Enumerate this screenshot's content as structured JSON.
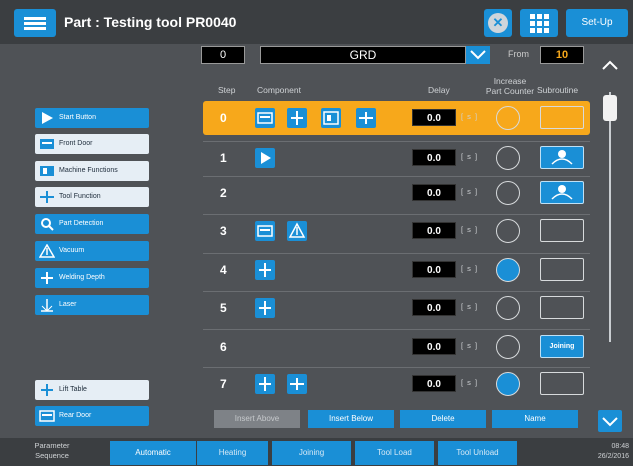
{
  "header": {
    "title": "Part : Testing tool PR0040",
    "setup_label": "Set-Up"
  },
  "selector": {
    "step_value": "0",
    "sequence_name": "GRD",
    "from_label": "From",
    "from_value": "10"
  },
  "columns": {
    "step": "Step",
    "component": "Component",
    "delay": "Delay",
    "increase_counter": "Increase\nPart Counter",
    "subroutine": "Subroutine"
  },
  "sidebar": {
    "items": [
      {
        "label": "Start Button",
        "icon": "play-icon"
      },
      {
        "label": "Front Door",
        "icon": "door-icon"
      },
      {
        "label": "Machine Functions",
        "icon": "machine-icon"
      },
      {
        "label": "Tool Function",
        "icon": "tool-icon"
      },
      {
        "label": "Part Detection",
        "icon": "detection-icon"
      },
      {
        "label": "Vacuum",
        "icon": "vacuum-icon"
      },
      {
        "label": "Welding Depth",
        "icon": "welding-depth-icon"
      },
      {
        "label": "Laser",
        "icon": "laser-icon"
      },
      {
        "label": "Lift Table",
        "icon": "lift-table-icon"
      },
      {
        "label": "Rear Door",
        "icon": "rear-door-icon"
      }
    ]
  },
  "rows": [
    {
      "step": "0",
      "delay": "0.0",
      "unit": "[ s ]",
      "subroutine": ""
    },
    {
      "step": "1",
      "delay": "0.0",
      "unit": "[ s ]",
      "subroutine": ""
    },
    {
      "step": "2",
      "delay": "0.0",
      "unit": "[ s ]",
      "subroutine": ""
    },
    {
      "step": "3",
      "delay": "0.0",
      "unit": "[ s ]",
      "subroutine": ""
    },
    {
      "step": "4",
      "delay": "0.0",
      "unit": "[ s ]",
      "subroutine": ""
    },
    {
      "step": "5",
      "delay": "0.0",
      "unit": "[ s ]",
      "subroutine": ""
    },
    {
      "step": "6",
      "delay": "0.0",
      "unit": "[ s ]",
      "subroutine": "Joining"
    },
    {
      "step": "7",
      "delay": "0.0",
      "unit": "[ s ]",
      "subroutine": ""
    }
  ],
  "actions": {
    "insert_above": "Insert Above",
    "insert_below": "Insert Below",
    "delete": "Delete",
    "name": "Name"
  },
  "footer": {
    "label": "Parameter Sequence",
    "tabs": [
      "Automatic",
      "Heating",
      "Joining",
      "Tool Load",
      "Tool Unload"
    ],
    "time": "08:48",
    "date": "26/2/2016"
  },
  "colors": {
    "accent": "#1a8fd6",
    "highlight": "#f7a81b",
    "background": "#4f5256"
  }
}
